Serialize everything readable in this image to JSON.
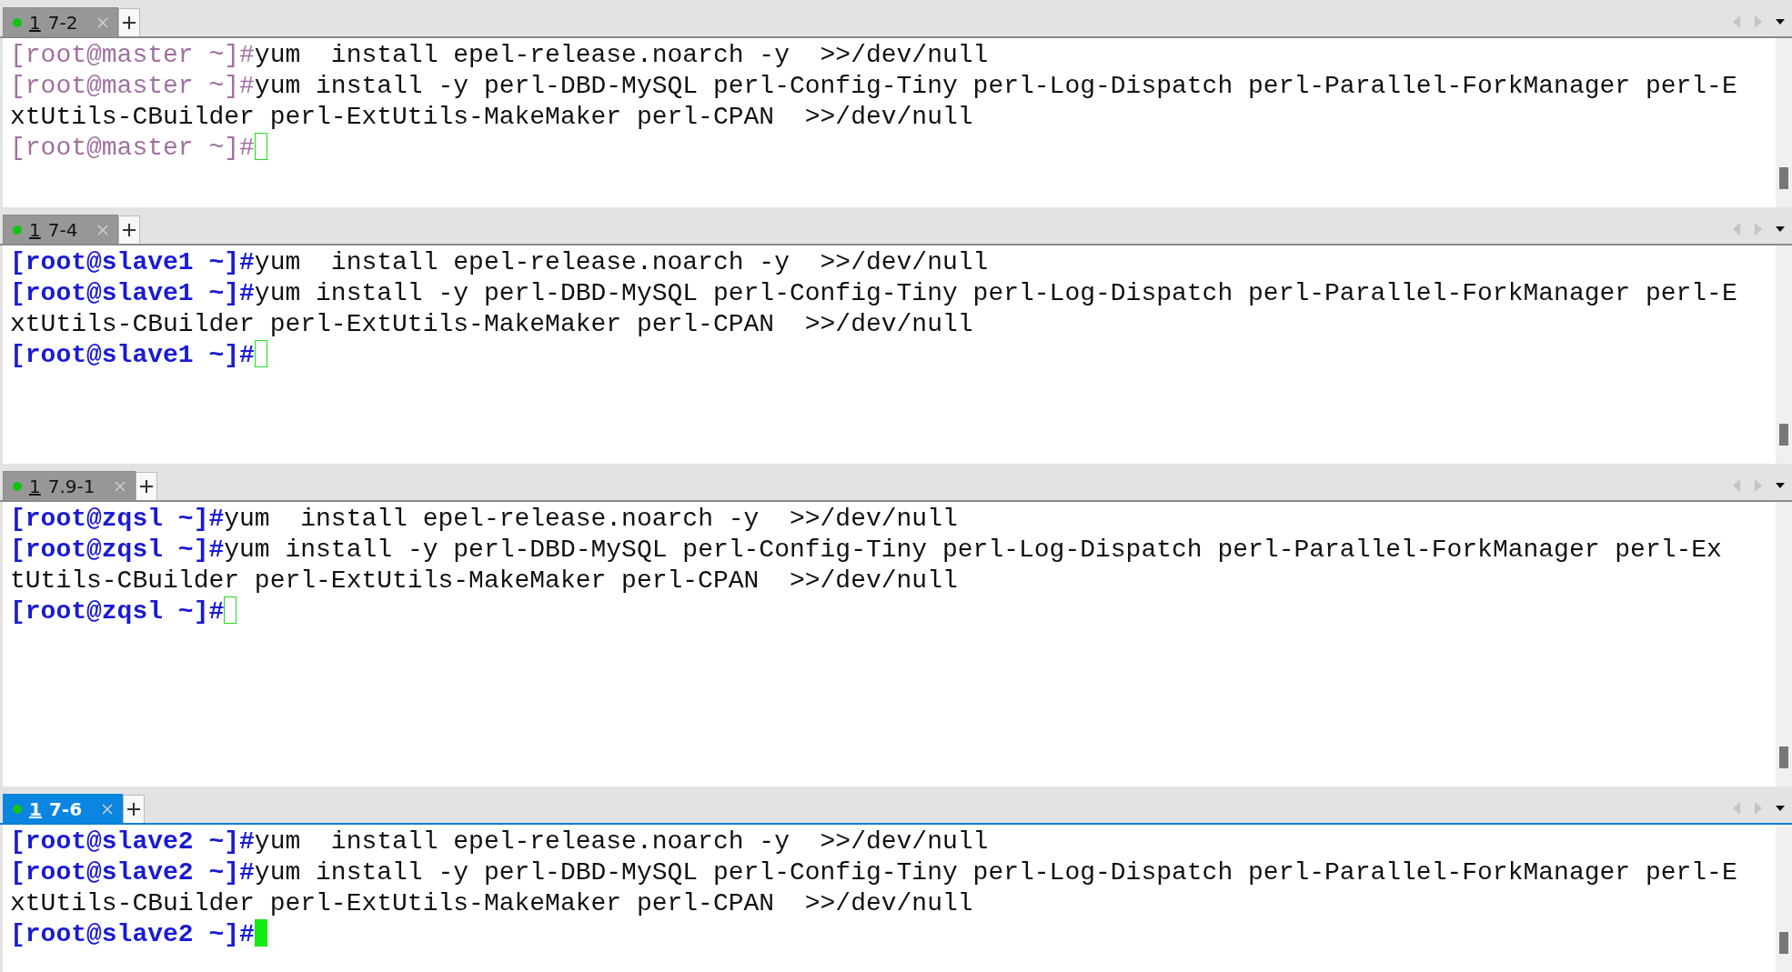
{
  "panes": [
    {
      "tab": {
        "number": "1",
        "label": "7-2",
        "selected": false
      },
      "color": "#a070a0",
      "kind": "plain",
      "lines": [
        {
          "prompt": "[root@master ~]#",
          "command": "yum  install epel-release.noarch -y  >>/dev/null"
        },
        {
          "prompt": "[root@master ~]#",
          "command": "yum install -y perl-DBD-MySQL perl-Config-Tiny perl-Log-Dispatch perl-Parallel-ForkManager perl-ExtUtils-CBuilder perl-ExtUtils-MakeMaker perl-CPAN  >>/dev/null"
        },
        {
          "prompt": "[root@master ~]#"
        }
      ]
    },
    {
      "tab": {
        "number": "1",
        "label": "7-4",
        "selected": false
      },
      "color": "#1a1ad2",
      "kind": "bold",
      "lines": [
        {
          "prompt": "[root@slave1 ~]#",
          "command": "yum  install epel-release.noarch -y  >>/dev/null"
        },
        {
          "prompt": "[root@slave1 ~]#",
          "command": "yum install -y perl-DBD-MySQL perl-Config-Tiny perl-Log-Dispatch perl-Parallel-ForkManager perl-ExtUtils-CBuilder perl-ExtUtils-MakeMaker perl-CPAN  >>/dev/null"
        },
        {
          "prompt": "[root@slave1 ~]#"
        }
      ]
    },
    {
      "tab": {
        "number": "1",
        "label": "7.9-1",
        "selected": false
      },
      "color": "#1a1ad2",
      "kind": "bold",
      "lines": [
        {
          "prompt": "[root@zqsl ~]#",
          "command": "yum  install epel-release.noarch -y  >>/dev/null"
        },
        {
          "prompt": "[root@zqsl ~]#",
          "command": "yum install -y perl-DBD-MySQL perl-Config-Tiny perl-Log-Dispatch perl-Parallel-ForkManager perl-ExtUtils-CBuilder perl-ExtUtils-MakeMaker perl-CPAN  >>/dev/null"
        },
        {
          "prompt": "[root@zqsl ~]#"
        }
      ]
    },
    {
      "tab": {
        "number": "1",
        "label": "7-6",
        "selected": true
      },
      "color": "#1a1ad2",
      "kind": "bold",
      "lines": [
        {
          "prompt": "[root@slave2 ~]#",
          "command": "yum  install epel-release.noarch -y  >>/dev/null"
        },
        {
          "prompt": "[root@slave2 ~]#",
          "command": "yum install -y perl-DBD-MySQL perl-Config-Tiny perl-Log-Dispatch perl-Parallel-ForkManager perl-ExtUtils-CBuilder perl-ExtUtils-MakeMaker perl-CPAN  >>/dev/null"
        },
        {
          "prompt": "[root@slave2 ~]#"
        }
      ]
    }
  ]
}
